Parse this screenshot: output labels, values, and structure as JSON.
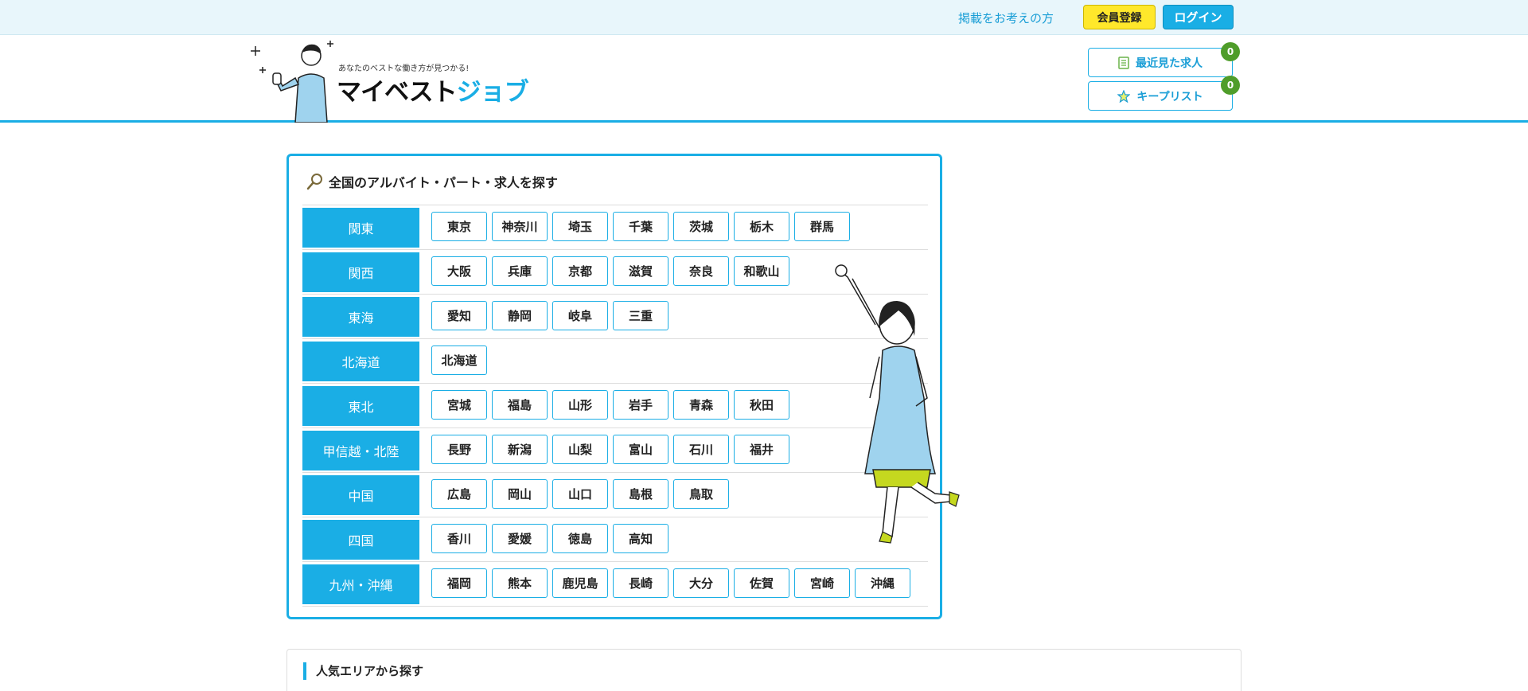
{
  "topbar": {
    "advertiser_link": "掲載をお考えの方",
    "register_button": "会員登録",
    "login_button": "ログイン"
  },
  "header": {
    "logo_tagline": "あなたのベストな働き方が見つかる!",
    "logo_brand_main": "マイベスト",
    "logo_brand_accent": "ジョブ",
    "recent_jobs_label": "最近見た求人",
    "recent_jobs_count": "0",
    "keep_list_label": "キープリスト",
    "keep_list_count": "0"
  },
  "search": {
    "title": "全国のアルバイト・パート・求人を探す",
    "regions": [
      {
        "name": "関東",
        "prefectures": [
          "東京",
          "神奈川",
          "埼玉",
          "千葉",
          "茨城",
          "栃木",
          "群馬"
        ]
      },
      {
        "name": "関西",
        "prefectures": [
          "大阪",
          "兵庫",
          "京都",
          "滋賀",
          "奈良",
          "和歌山"
        ]
      },
      {
        "name": "東海",
        "prefectures": [
          "愛知",
          "静岡",
          "岐阜",
          "三重"
        ]
      },
      {
        "name": "北海道",
        "prefectures": [
          "北海道"
        ]
      },
      {
        "name": "東北",
        "prefectures": [
          "宮城",
          "福島",
          "山形",
          "岩手",
          "青森",
          "秋田"
        ]
      },
      {
        "name": "甲信越・北陸",
        "prefectures": [
          "長野",
          "新潟",
          "山梨",
          "富山",
          "石川",
          "福井"
        ]
      },
      {
        "name": "中国",
        "prefectures": [
          "広島",
          "岡山",
          "山口",
          "島根",
          "鳥取"
        ]
      },
      {
        "name": "四国",
        "prefectures": [
          "香川",
          "愛媛",
          "徳島",
          "高知"
        ]
      },
      {
        "name": "九州・沖縄",
        "prefectures": [
          "福岡",
          "熊本",
          "鹿児島",
          "長崎",
          "大分",
          "佐賀",
          "宮崎",
          "沖縄"
        ]
      }
    ]
  },
  "popular": {
    "title": "人気エリアから探す"
  },
  "colors": {
    "accent": "#1aaee5",
    "register_yellow": "#ffe82b",
    "badge_green": "#4f9d2a",
    "topbar_bg": "#e8f6fb"
  },
  "icons": [
    "document-icon",
    "star-icon",
    "magnifier-icon"
  ]
}
